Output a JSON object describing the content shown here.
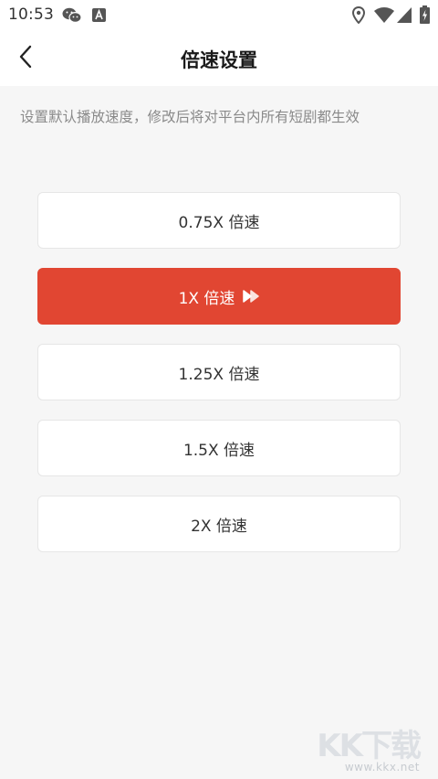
{
  "status_bar": {
    "time": "10:53",
    "icons": [
      "wechat-icon",
      "font-app-icon",
      "location-icon",
      "wifi-icon",
      "signal-icon",
      "battery-charging-icon"
    ]
  },
  "header": {
    "title": "倍速设置",
    "back_icon": "chevron-left-icon"
  },
  "description": "设置默认播放速度，修改后将对平台内所有短剧都生效",
  "speed_options": [
    {
      "label": "0.75X 倍速",
      "selected": false
    },
    {
      "label": "1X 倍速",
      "selected": true
    },
    {
      "label": "1.25X 倍速",
      "selected": false
    },
    {
      "label": "1.5X 倍速",
      "selected": false
    },
    {
      "label": "2X 倍速",
      "selected": false
    }
  ],
  "selected_indicator_icon": "fast-forward-icon",
  "watermark": {
    "logo": "KK下载",
    "url": "www.kkx.net"
  },
  "colors": {
    "accent": "#e14632",
    "background": "#f6f6f6",
    "description_text": "#8a8a8a"
  }
}
